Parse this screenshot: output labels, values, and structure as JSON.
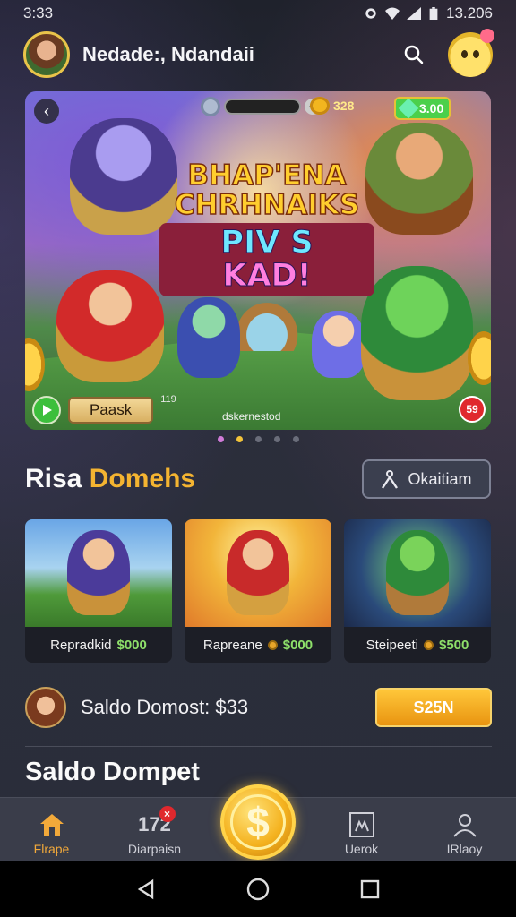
{
  "status_bar": {
    "time": "3:33",
    "battery": "13.206"
  },
  "header": {
    "title": "Nedade:, Ndandaii"
  },
  "banner": {
    "title_line1": "BHAP'ENA",
    "title_line2": "CHRHNAIKS",
    "title_line3a": "PIV S ",
    "title_line3b": "KAD!",
    "hud_gold": "328",
    "hud_gems": "3.00",
    "play_label": "Paask",
    "play_number": "119",
    "caption": "dskernestod",
    "badge": "59"
  },
  "carousel": {
    "count": 5,
    "active_index": 1
  },
  "section": {
    "title_part1": "Risa ",
    "title_part2": "Domehs",
    "button_label": "Okaitiam"
  },
  "cards": [
    {
      "name": "Repradkid",
      "price": "$000"
    },
    {
      "name": "Rapreane",
      "price": "$000"
    },
    {
      "name": "Steipeeti",
      "price": "$500"
    }
  ],
  "saldo": {
    "text": "Saldo Domost: $33",
    "button_label": "S25N",
    "heading": "Saldo Dompet"
  },
  "bottom_nav": [
    {
      "label": "Flrape",
      "icon": "home-icon"
    },
    {
      "label": "Diarpaisn",
      "icon": "counter-icon",
      "icon_text": "172"
    },
    {
      "label": "Uerok",
      "icon": "frame-face-icon"
    },
    {
      "label": "IRlaoy",
      "icon": "profile-icon"
    }
  ],
  "center_button": {
    "symbol": "$"
  },
  "colors": {
    "accent_gold": "#f4b431",
    "active_nav": "#f2a93a",
    "price_green": "#8ee06a"
  }
}
